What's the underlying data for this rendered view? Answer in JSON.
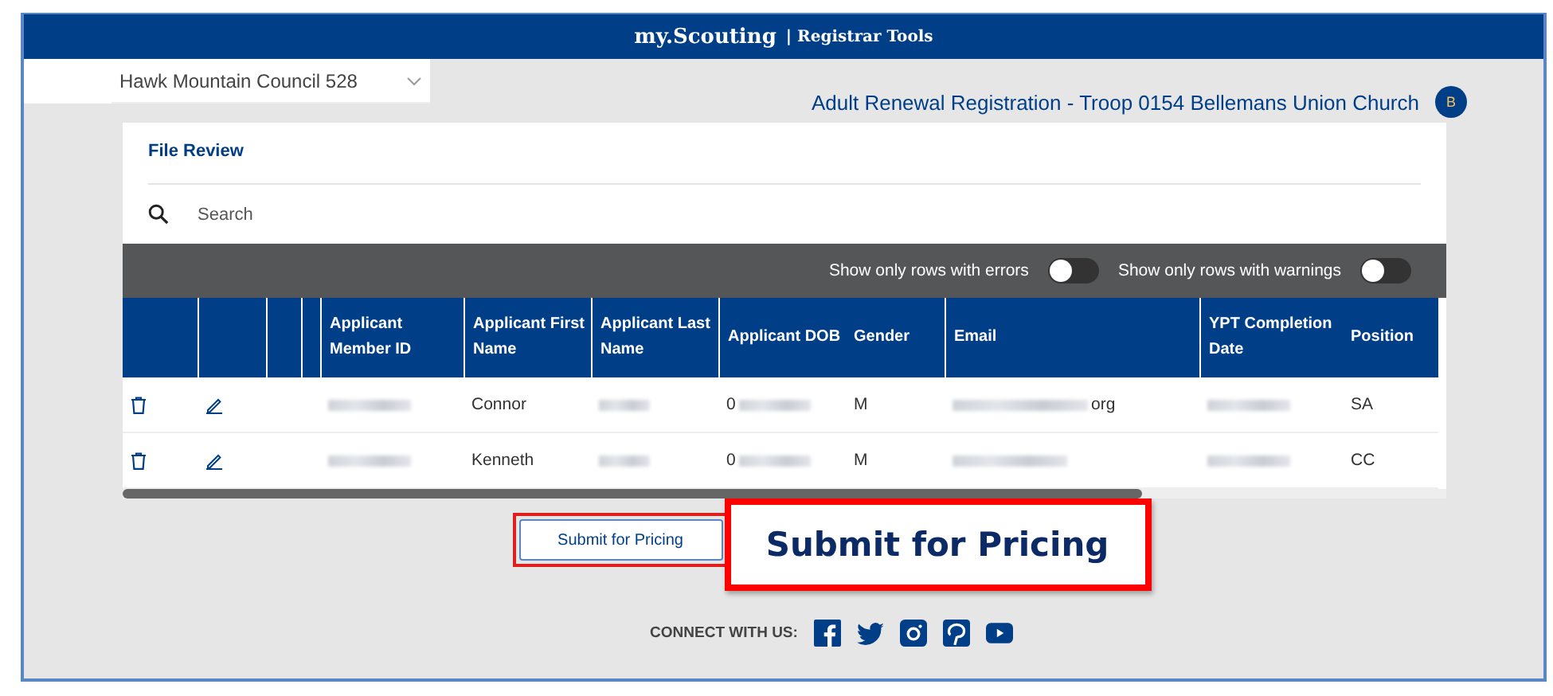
{
  "header": {
    "brand": "my.Scouting",
    "section": "| Registrar Tools"
  },
  "council_select": {
    "value": "Hawk Mountain Council 528"
  },
  "page_title": "Adult Renewal Registration -  Troop 0154 Bellemans Union Church",
  "avatar": "B",
  "card": {
    "title": "File Review",
    "search": {
      "placeholder": "Search"
    }
  },
  "filters": [
    {
      "label": "Show only rows with errors",
      "on": false
    },
    {
      "label": "Show only rows with warnings",
      "on": false
    }
  ],
  "columns": [
    "Applicant Member ID",
    "Applicant First Name",
    "Applicant Last Name",
    "Applicant DOB",
    "Gender",
    "Email",
    "YPT Completion Date",
    "Position"
  ],
  "rows": [
    {
      "first_name": "Connor",
      "dob_prefix": "0",
      "gender": "M",
      "email_suffix": "org",
      "position": "SA"
    },
    {
      "first_name": "Kenneth",
      "dob_prefix": "0",
      "gender": "M",
      "position": "CC"
    }
  ],
  "submit_button": "Submit for Pricing",
  "callout": "Submit for Pricing",
  "footer": {
    "connect": "CONNECT WITH US:"
  }
}
